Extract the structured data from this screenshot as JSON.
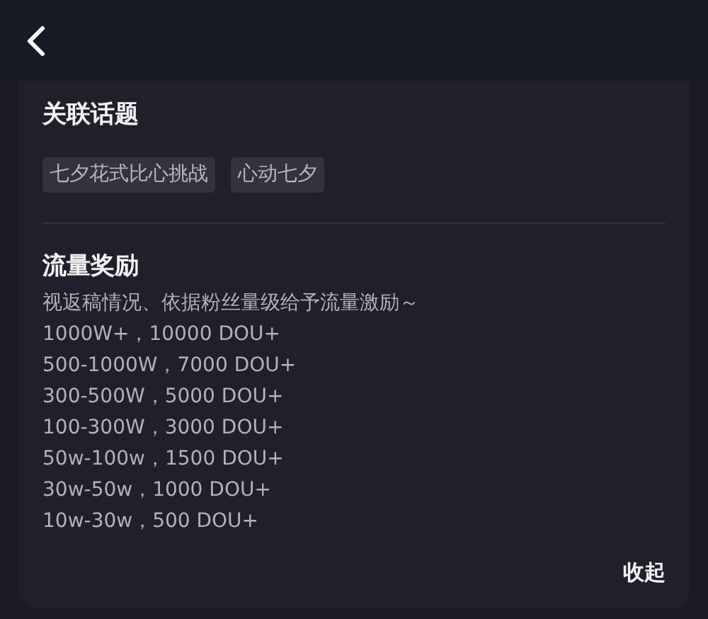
{
  "topics": {
    "title": "关联话题",
    "tags": [
      "七夕花式比心挑战",
      "心动七夕"
    ]
  },
  "rewards": {
    "title": "流量奖励",
    "intro": "视返稿情况、依据粉丝量级给予流量激励～",
    "lines": [
      "1000W+，10000 DOU+",
      "500-1000W，7000 DOU+",
      "300-500W，5000 DOU+",
      "100-300W，3000 DOU+",
      "50w-100w，1500 DOU+",
      "30w-50w，1000 DOU+",
      "10w-30w，500 DOU+"
    ]
  },
  "collapse_link": "收起"
}
